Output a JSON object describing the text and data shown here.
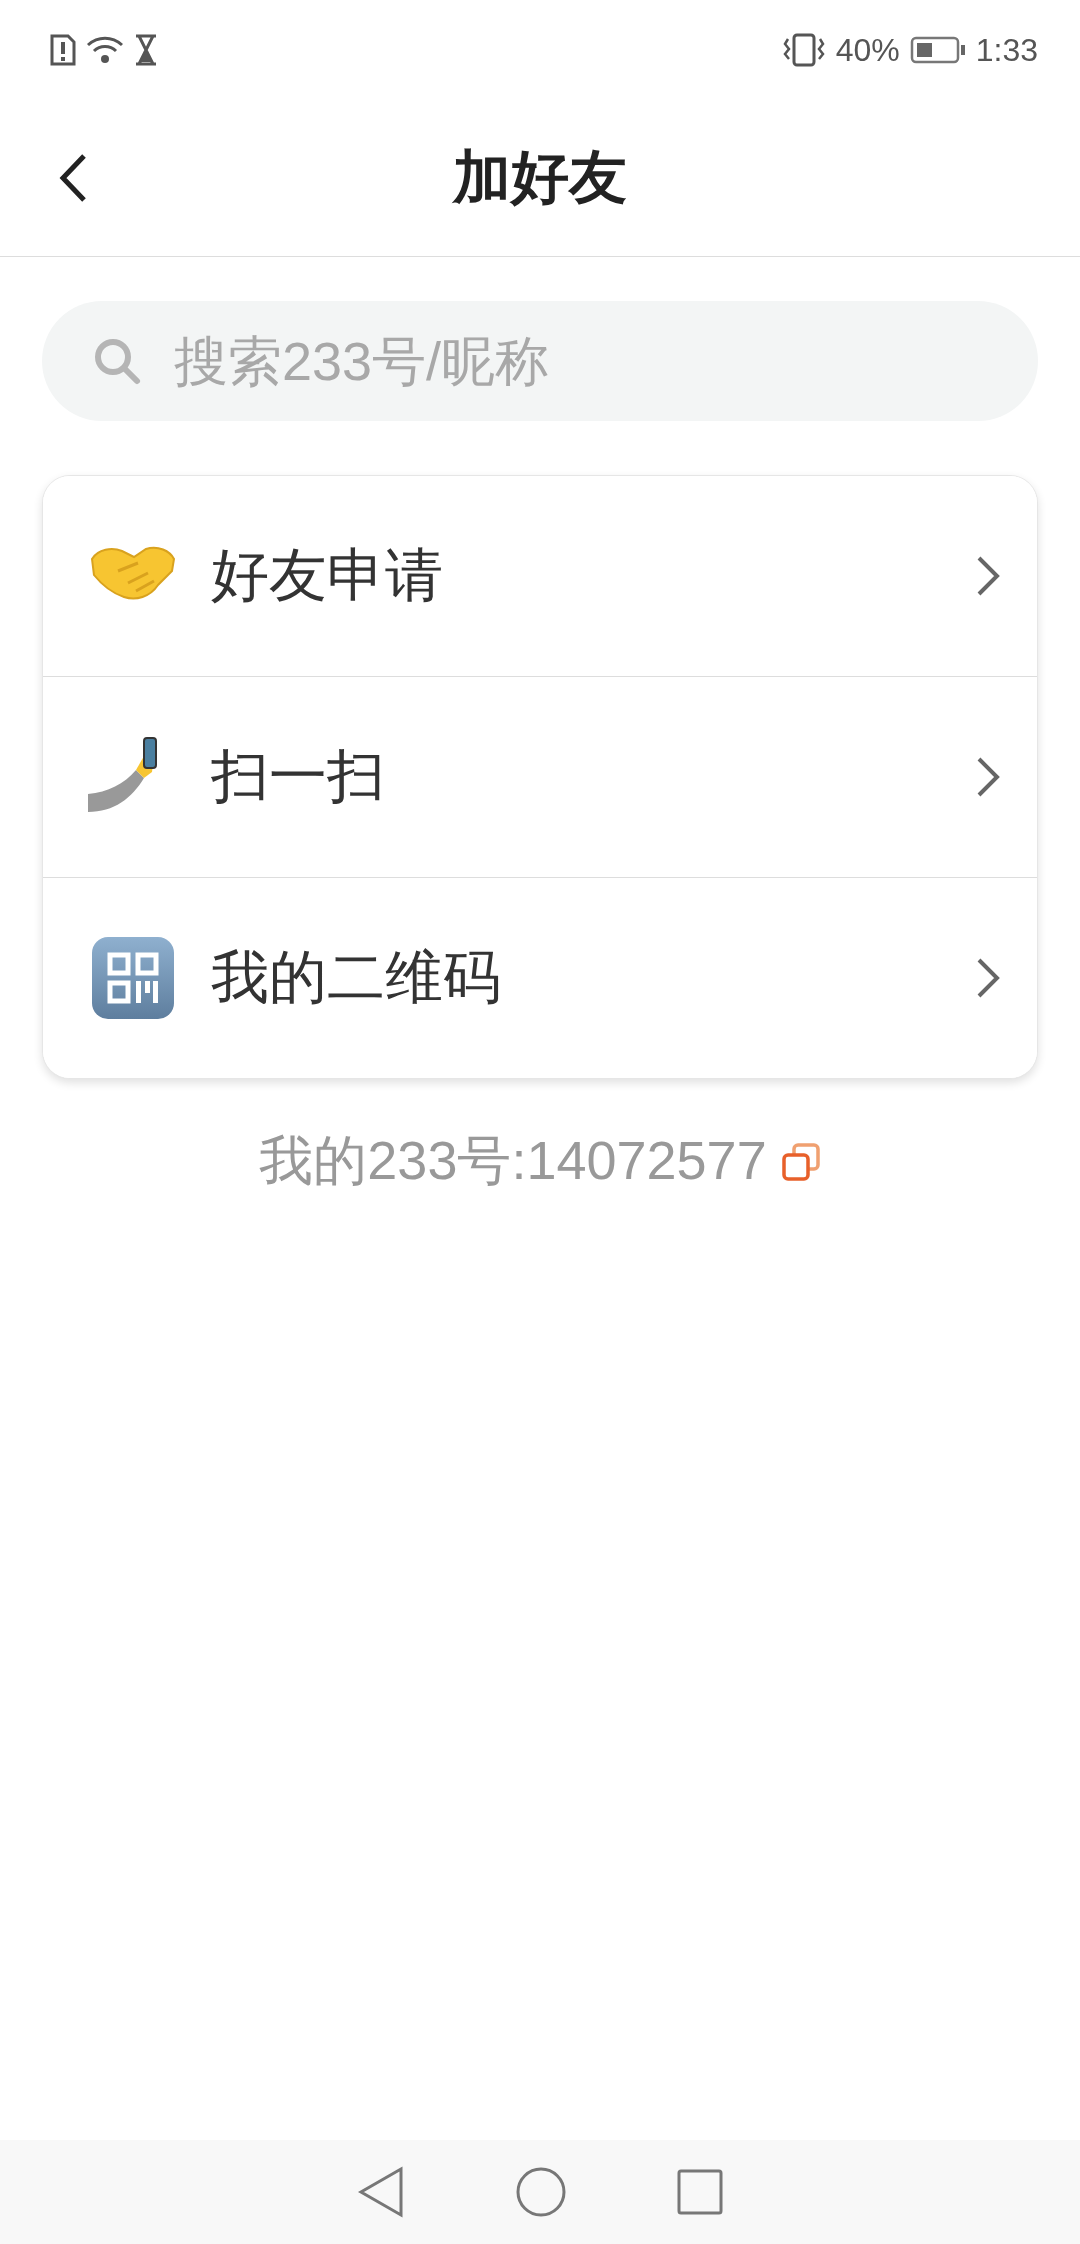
{
  "status_bar": {
    "battery": "40%",
    "time": "1:33"
  },
  "header": {
    "title": "加好友"
  },
  "search": {
    "placeholder": "搜索233号/昵称"
  },
  "menu": [
    {
      "label": "好友申请"
    },
    {
      "label": "扫一扫"
    },
    {
      "label": "我的二维码"
    }
  ],
  "my_id": "我的233号:14072577"
}
